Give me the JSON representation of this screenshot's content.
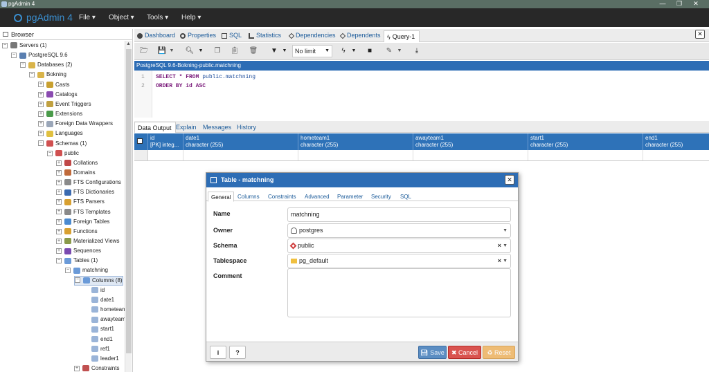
{
  "window": {
    "title": "pgAdmin 4",
    "controls": [
      "—",
      "❐",
      "✕"
    ]
  },
  "menubar": {
    "logo": "pgAdmin 4",
    "items": [
      "File",
      "Object",
      "Tools",
      "Help"
    ]
  },
  "browser": {
    "title": "Browser",
    "tree": [
      {
        "label": "Servers (1)",
        "level": 0,
        "exp": "−",
        "icon": "servers-icon",
        "color": "#777"
      },
      {
        "label": "PostgreSQL 9.6",
        "level": 1,
        "exp": "−",
        "icon": "postgresql-server-icon",
        "color": "#5a7fb0"
      },
      {
        "label": "Databases (2)",
        "level": 2,
        "exp": "−",
        "icon": "databases-icon",
        "color": "#d9b44a"
      },
      {
        "label": "Bokning",
        "level": 3,
        "exp": "−",
        "icon": "database-icon",
        "color": "#d9b44a"
      },
      {
        "label": "Casts",
        "level": 4,
        "exp": "+",
        "icon": "casts-icon",
        "color": "#c8a030"
      },
      {
        "label": "Catalogs",
        "level": 4,
        "exp": "+",
        "icon": "catalogs-icon",
        "color": "#8a4ab0"
      },
      {
        "label": "Event Triggers",
        "level": 4,
        "exp": "+",
        "icon": "event-triggers-icon",
        "color": "#c0a040"
      },
      {
        "label": "Extensions",
        "level": 4,
        "exp": "+",
        "icon": "extensions-icon",
        "color": "#4a9a4a"
      },
      {
        "label": "Foreign Data Wrappers",
        "level": 4,
        "exp": "+",
        "icon": "foreign-data-wrappers-icon",
        "color": "#9aa6b8"
      },
      {
        "label": "Languages",
        "level": 4,
        "exp": "+",
        "icon": "languages-icon",
        "color": "#e0c040"
      },
      {
        "label": "Schemas (1)",
        "level": 4,
        "exp": "−",
        "icon": "schemas-icon",
        "color": "#d05050"
      },
      {
        "label": "public",
        "level": 5,
        "exp": "−",
        "icon": "schema-icon",
        "color": "#d05050"
      },
      {
        "label": "Collations",
        "level": 6,
        "exp": "+",
        "icon": "collations-icon",
        "color": "#c04848"
      },
      {
        "label": "Domains",
        "level": 6,
        "exp": "+",
        "icon": "domains-icon",
        "color": "#c06a3a"
      },
      {
        "label": "FTS Configurations",
        "level": 6,
        "exp": "+",
        "icon": "fts-configurations-icon",
        "color": "#8a8a8a"
      },
      {
        "label": "FTS Dictionaries",
        "level": 6,
        "exp": "+",
        "icon": "fts-dictionaries-icon",
        "color": "#3a6ab0"
      },
      {
        "label": "FTS Parsers",
        "level": 6,
        "exp": "+",
        "icon": "fts-parsers-icon",
        "color": "#d8a030"
      },
      {
        "label": "FTS Templates",
        "level": 6,
        "exp": "+",
        "icon": "fts-templates-icon",
        "color": "#8a8a8a"
      },
      {
        "label": "Foreign Tables",
        "level": 6,
        "exp": "+",
        "icon": "foreign-tables-icon",
        "color": "#4a8ad0"
      },
      {
        "label": "Functions",
        "level": 6,
        "exp": "+",
        "icon": "functions-icon",
        "color": "#d8a030"
      },
      {
        "label": "Materialized Views",
        "level": 6,
        "exp": "+",
        "icon": "materialized-views-icon",
        "color": "#8a9a4a"
      },
      {
        "label": "Sequences",
        "level": 6,
        "exp": "+",
        "icon": "sequences-icon",
        "color": "#7a4ab0"
      },
      {
        "label": "Tables (1)",
        "level": 6,
        "exp": "−",
        "icon": "tables-icon",
        "color": "#6a9ad8"
      },
      {
        "label": "matchning",
        "level": 7,
        "exp": "−",
        "icon": "table-icon",
        "color": "#6a9ad8"
      },
      {
        "label": "Columns (8)",
        "level": 8,
        "exp": "−",
        "icon": "columns-icon",
        "color": "#6a9ad8",
        "selected": true
      },
      {
        "label": "id",
        "level": 9,
        "exp": "",
        "icon": "column-icon",
        "color": "#9ab4d8"
      },
      {
        "label": "date1",
        "level": 9,
        "exp": "",
        "icon": "column-icon",
        "color": "#9ab4d8"
      },
      {
        "label": "hometeam",
        "level": 9,
        "exp": "",
        "icon": "column-icon",
        "color": "#9ab4d8"
      },
      {
        "label": "awayteam",
        "level": 9,
        "exp": "",
        "icon": "column-icon",
        "color": "#9ab4d8"
      },
      {
        "label": "start1",
        "level": 9,
        "exp": "",
        "icon": "column-icon",
        "color": "#9ab4d8"
      },
      {
        "label": "end1",
        "level": 9,
        "exp": "",
        "icon": "column-icon",
        "color": "#9ab4d8"
      },
      {
        "label": "ref1",
        "level": 9,
        "exp": "",
        "icon": "column-icon",
        "color": "#9ab4d8"
      },
      {
        "label": "leader1",
        "level": 9,
        "exp": "",
        "icon": "column-icon",
        "color": "#9ab4d8"
      },
      {
        "label": "Constraints",
        "level": 8,
        "exp": "+",
        "icon": "constraints-icon",
        "color": "#c05050"
      }
    ]
  },
  "tabs": [
    {
      "label": "Dashboard",
      "icon": "dashboard-icon"
    },
    {
      "label": "Properties",
      "icon": "properties-icon"
    },
    {
      "label": "SQL",
      "icon": "sql-icon"
    },
    {
      "label": "Statistics",
      "icon": "statistics-icon"
    },
    {
      "label": "Dependencies",
      "icon": "dependencies-icon"
    },
    {
      "label": "Dependents",
      "icon": "dependents-icon"
    },
    {
      "label": "Query-1",
      "icon": "query-icon"
    }
  ],
  "toolbar": {
    "limit": "No limit"
  },
  "query": {
    "title": "PostgreSQL 9.6-Bokning-public.matchning",
    "lines": [
      {
        "no": "1",
        "kw1": "SELECT * FROM ",
        "ident": "public.matchning"
      },
      {
        "no": "2",
        "kw1": "ORDER BY id ASC",
        "ident": ""
      }
    ]
  },
  "results": {
    "tabs": [
      "Data Output",
      "Explain",
      "Messages",
      "History"
    ],
    "columns": [
      {
        "name": "id",
        "type": "[PK] integ..."
      },
      {
        "name": "date1",
        "type": "character (255)"
      },
      {
        "name": "hometeam1",
        "type": "character (255)"
      },
      {
        "name": "awayteam1",
        "type": "character (255)"
      },
      {
        "name": "start1",
        "type": "character (255)"
      },
      {
        "name": "end1",
        "type": "character (255)"
      }
    ]
  },
  "dialog": {
    "title": "Table - matchning",
    "tabs": [
      "General",
      "Columns",
      "Constraints",
      "Advanced",
      "Parameter",
      "Security",
      "SQL"
    ],
    "fields": {
      "name": {
        "label": "Name",
        "value": "matchning"
      },
      "owner": {
        "label": "Owner",
        "value": "postgres",
        "icon": "user-icon"
      },
      "schema": {
        "label": "Schema",
        "value": "public",
        "icon": "schema-icon"
      },
      "tablespace": {
        "label": "Tablespace",
        "value": "pg_default",
        "icon": "folder-icon"
      },
      "comment": {
        "label": "Comment",
        "value": ""
      }
    },
    "buttons": {
      "info": "i",
      "help": "?",
      "save": "Save",
      "cancel": "Cancel",
      "reset": "Reset"
    }
  }
}
